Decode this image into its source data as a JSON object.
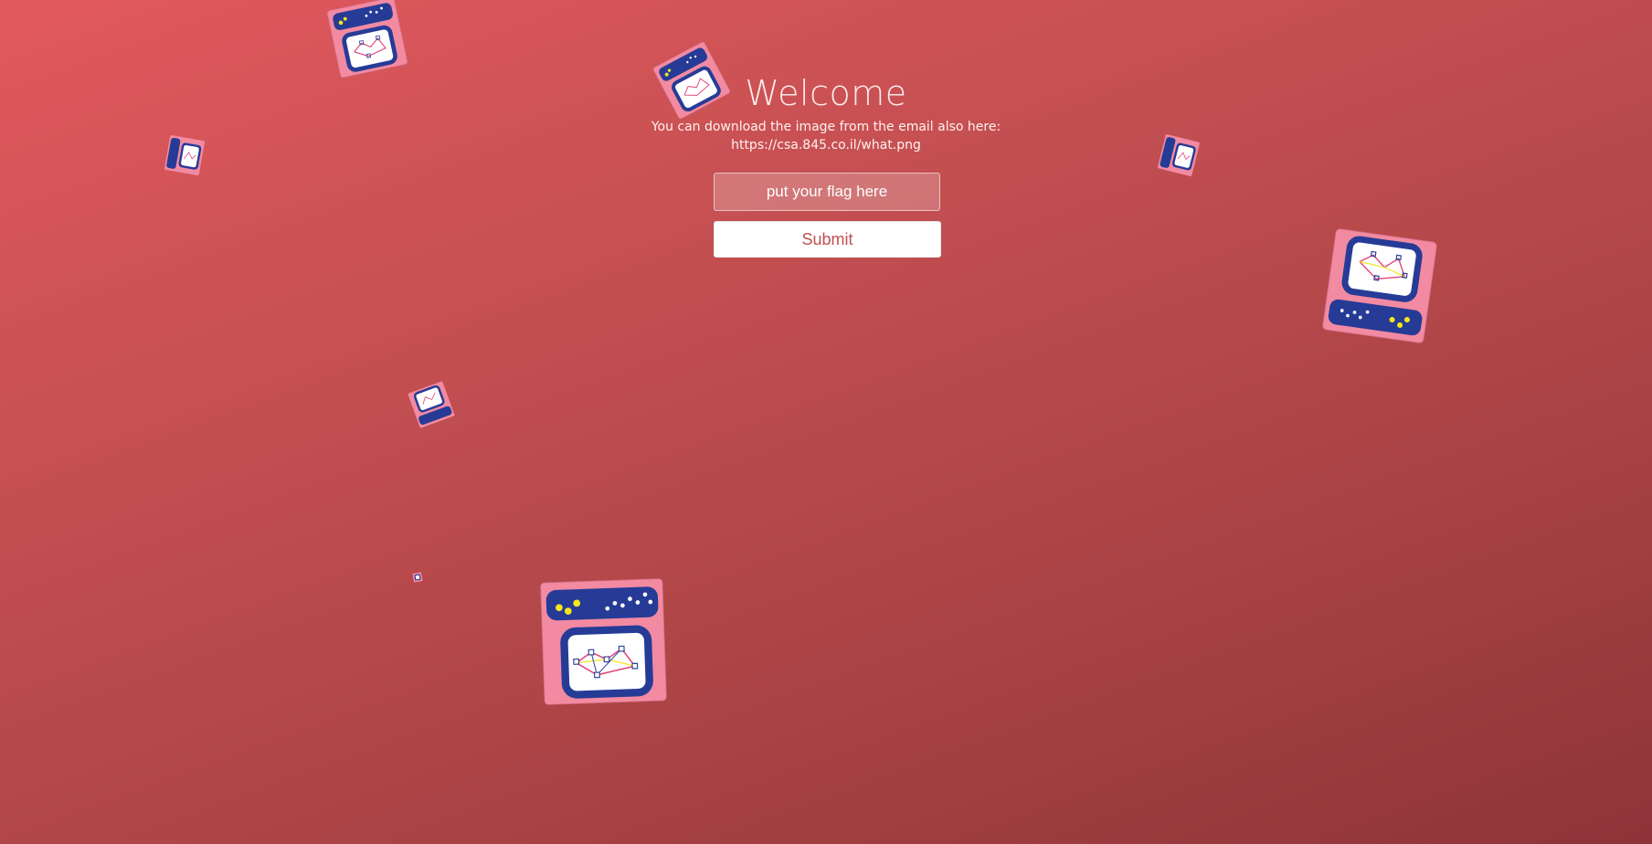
{
  "page": {
    "title": "Welcome",
    "instruction": "You can download the image from the email also here:",
    "link": "https://csa.845.co.il/what.png"
  },
  "form": {
    "flag_placeholder": "put your flag here",
    "flag_value": "",
    "submit_label": "Submit"
  },
  "colors": {
    "background_start": "#e2595d",
    "background_end": "#8e3438",
    "card_pink": "#f28aa2",
    "panel_navy": "#263b96",
    "accent_yellow": "#f4e61c"
  },
  "decorations": [
    {
      "icon": "computer-card-icon"
    },
    {
      "icon": "computer-card-icon"
    },
    {
      "icon": "computer-card-icon"
    },
    {
      "icon": "computer-card-icon"
    },
    {
      "icon": "computer-card-icon"
    },
    {
      "icon": "computer-card-icon"
    },
    {
      "icon": "computer-card-icon"
    },
    {
      "icon": "computer-card-icon"
    }
  ]
}
